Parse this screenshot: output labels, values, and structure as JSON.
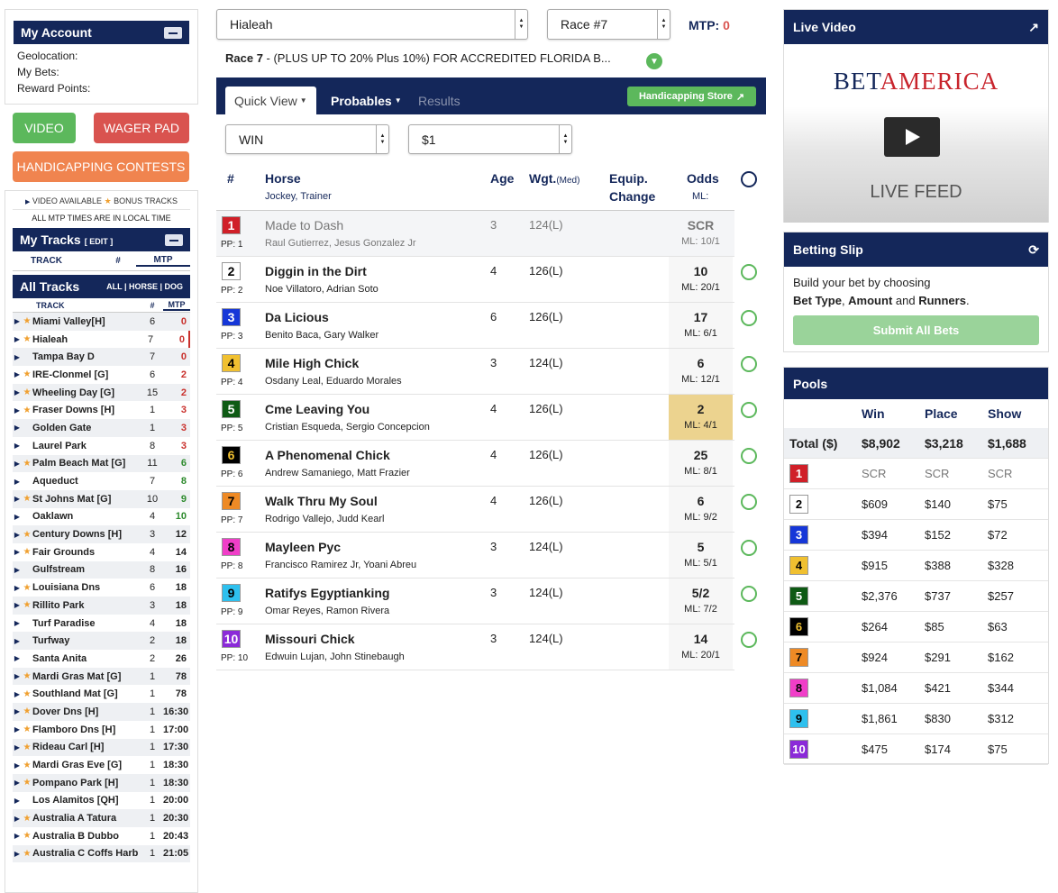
{
  "account": {
    "title": "My Account",
    "geo": "Geolocation:",
    "bets": "My Bets:",
    "points": "Reward Points:"
  },
  "buttons": {
    "video": "VIDEO",
    "wager": "WAGER PAD",
    "contests": "HANDICAPPING CONTESTS"
  },
  "legend": {
    "video": "VIDEO AVAILABLE",
    "bonus": "BONUS TRACKS",
    "times": "ALL MTP TIMES ARE IN LOCAL TIME"
  },
  "mytracks": {
    "title": "My Tracks",
    "edit": "[ EDIT ]",
    "col_track": "TRACK",
    "col_num": "#",
    "col_mtp": "MTP"
  },
  "alltracks": {
    "title": "All Tracks",
    "filter": "ALL | HORSE | DOG",
    "col_track": "TRACK",
    "col_num": "#",
    "col_mtp": "MTP"
  },
  "tracks": [
    {
      "name": "Miami Valley[H]",
      "n": "6",
      "m": "0",
      "star": true,
      "c": "red"
    },
    {
      "name": "Hialeah",
      "n": "7",
      "m": "0",
      "star": true,
      "c": "red"
    },
    {
      "name": "Tampa Bay D",
      "n": "7",
      "m": "0",
      "star": false,
      "c": "red"
    },
    {
      "name": "IRE-Clonmel [G]",
      "n": "6",
      "m": "2",
      "star": true,
      "c": "red"
    },
    {
      "name": "Wheeling Day [G]",
      "n": "15",
      "m": "2",
      "star": true,
      "c": "red"
    },
    {
      "name": "Fraser Downs [H]",
      "n": "1",
      "m": "3",
      "star": true,
      "c": "red"
    },
    {
      "name": "Golden Gate",
      "n": "1",
      "m": "3",
      "star": false,
      "c": "red"
    },
    {
      "name": "Laurel Park",
      "n": "8",
      "m": "3",
      "star": false,
      "c": "red"
    },
    {
      "name": "Palm Beach Mat [G]",
      "n": "11",
      "m": "6",
      "star": true,
      "c": "green"
    },
    {
      "name": "Aqueduct",
      "n": "7",
      "m": "8",
      "star": false,
      "c": "green"
    },
    {
      "name": "St Johns Mat [G]",
      "n": "10",
      "m": "9",
      "star": true,
      "c": "green"
    },
    {
      "name": "Oaklawn",
      "n": "4",
      "m": "10",
      "star": false,
      "c": "green"
    },
    {
      "name": "Century Downs [H]",
      "n": "3",
      "m": "12",
      "star": true,
      "c": "dark"
    },
    {
      "name": "Fair Grounds",
      "n": "4",
      "m": "14",
      "star": true,
      "c": "dark"
    },
    {
      "name": "Gulfstream",
      "n": "8",
      "m": "16",
      "star": false,
      "c": "dark"
    },
    {
      "name": "Louisiana Dns",
      "n": "6",
      "m": "18",
      "star": true,
      "c": "dark"
    },
    {
      "name": "Rillito Park",
      "n": "3",
      "m": "18",
      "star": true,
      "c": "dark"
    },
    {
      "name": "Turf Paradise",
      "n": "4",
      "m": "18",
      "star": false,
      "c": "dark"
    },
    {
      "name": "Turfway",
      "n": "2",
      "m": "18",
      "star": false,
      "c": "dark"
    },
    {
      "name": "Santa Anita",
      "n": "2",
      "m": "26",
      "star": false,
      "c": "dark"
    },
    {
      "name": "Mardi Gras Mat [G]",
      "n": "1",
      "m": "78",
      "star": true,
      "c": "dark"
    },
    {
      "name": "Southland Mat [G]",
      "n": "1",
      "m": "78",
      "star": true,
      "c": "dark"
    },
    {
      "name": "Dover Dns [H]",
      "n": "1",
      "m": "16:30",
      "star": true,
      "c": "dark"
    },
    {
      "name": "Flamboro Dns [H]",
      "n": "1",
      "m": "17:00",
      "star": true,
      "c": "dark"
    },
    {
      "name": "Rideau Carl [H]",
      "n": "1",
      "m": "17:30",
      "star": true,
      "c": "dark"
    },
    {
      "name": "Mardi Gras Eve [G]",
      "n": "1",
      "m": "18:30",
      "star": true,
      "c": "dark"
    },
    {
      "name": "Pompano Park [H]",
      "n": "1",
      "m": "18:30",
      "star": true,
      "c": "dark"
    },
    {
      "name": "Los Alamitos [QH]",
      "n": "1",
      "m": "20:00",
      "star": false,
      "c": "dark"
    },
    {
      "name": "Australia A Tatura",
      "n": "1",
      "m": "20:30",
      "star": true,
      "c": "dark"
    },
    {
      "name": "Australia B Dubbo",
      "n": "1",
      "m": "20:43",
      "star": true,
      "c": "dark"
    },
    {
      "name": "Australia C Coffs Harb",
      "n": "1",
      "m": "21:05",
      "star": true,
      "c": "dark"
    }
  ],
  "race": {
    "track": "Hialeah",
    "race": "Race #7",
    "mtp_label": "MTP:",
    "mtp": "0",
    "title_prefix": "Race 7",
    "title": " - (PLUS UP TO 20% Plus 10%) FOR ACCREDITED FLORIDA B..."
  },
  "tabs": {
    "quick": "Quick View",
    "probables": "Probables",
    "results": "Results",
    "store": "Handicapping Store"
  },
  "filters": {
    "type": "WIN",
    "amount": "$1"
  },
  "headers": {
    "num": "#",
    "horse": "Horse",
    "jockey": "Jockey, Trainer",
    "age": "Age",
    "wgt": "Wgt.",
    "med": "(Med)",
    "equip1": "Equip.",
    "equip2": "Change",
    "odds": "Odds",
    "ml": "ML:"
  },
  "runners": [
    {
      "n": "1",
      "pp": "PP: 1",
      "horse": "Made to Dash",
      "jt": "Raul Gutierrez, Jesus Gonzalez Jr",
      "age": "3",
      "wgt": "124(L)",
      "odds": "SCR",
      "ml": "ML: 10/1",
      "bg": "#d01f28",
      "fg": "#fff",
      "scr": true
    },
    {
      "n": "2",
      "pp": "PP: 2",
      "horse": "Diggin in the Dirt",
      "jt": "Noe Villatoro, Adrian Soto",
      "age": "4",
      "wgt": "126(L)",
      "odds": "10",
      "ml": "ML: 20/1",
      "bg": "#ffffff",
      "fg": "#000"
    },
    {
      "n": "3",
      "pp": "PP: 3",
      "horse": "Da Licious",
      "jt": "Benito Baca, Gary Walker",
      "age": "6",
      "wgt": "126(L)",
      "odds": "17",
      "ml": "ML: 6/1",
      "bg": "#1637d8",
      "fg": "#fff"
    },
    {
      "n": "4",
      "pp": "PP: 4",
      "horse": "Mile High Chick",
      "jt": "Osdany Leal, Eduardo Morales",
      "age": "3",
      "wgt": "124(L)",
      "odds": "6",
      "ml": "ML: 12/1",
      "bg": "#f0c030",
      "fg": "#000"
    },
    {
      "n": "5",
      "pp": "PP: 5",
      "horse": "Cme Leaving You",
      "jt": "Cristian Esqueda, Sergio Concepcion",
      "age": "4",
      "wgt": "126(L)",
      "odds": "2",
      "ml": "ML: 4/1",
      "bg": "#0e5a14",
      "fg": "#fff",
      "fav": true
    },
    {
      "n": "6",
      "pp": "PP: 6",
      "horse": "A Phenomenal Chick",
      "jt": "Andrew Samaniego, Matt Frazier",
      "age": "4",
      "wgt": "126(L)",
      "odds": "25",
      "ml": "ML: 8/1",
      "bg": "#000000",
      "fg": "#f0c030"
    },
    {
      "n": "7",
      "pp": "PP: 7",
      "horse": "Walk Thru My Soul",
      "jt": "Rodrigo Vallejo, Judd Kearl",
      "age": "4",
      "wgt": "126(L)",
      "odds": "6",
      "ml": "ML: 9/2",
      "bg": "#ee8a25",
      "fg": "#000"
    },
    {
      "n": "8",
      "pp": "PP: 8",
      "horse": "Mayleen Pyc",
      "jt": "Francisco Ramirez Jr, Yoani Abreu",
      "age": "3",
      "wgt": "124(L)",
      "odds": "5",
      "ml": "ML: 5/1",
      "bg": "#f03ec8",
      "fg": "#000"
    },
    {
      "n": "9",
      "pp": "PP: 9",
      "horse": "Ratifys Egyptianking",
      "jt": "Omar Reyes, Ramon Rivera",
      "age": "3",
      "wgt": "124(L)",
      "odds": "5/2",
      "ml": "ML: 7/2",
      "bg": "#2ec0ee",
      "fg": "#000"
    },
    {
      "n": "10",
      "pp": "PP: 10",
      "horse": "Missouri Chick",
      "jt": "Edwuin Lujan, John Stinebaugh",
      "age": "3",
      "wgt": "124(L)",
      "odds": "14",
      "ml": "ML: 20/1",
      "bg": "#8b2ad8",
      "fg": "#fff"
    }
  ],
  "video": {
    "title": "Live Video",
    "brand_a": "BET",
    "brand_b": "AMERICA",
    "feed": "LIVE FEED"
  },
  "slip": {
    "title": "Betting Slip",
    "line1": "Build your bet by choosing",
    "bt": "Bet Type",
    "c1": ", ",
    "amt": "Amount",
    "and": " and ",
    "run": "Runners",
    "dot": ".",
    "submit": "Submit All Bets"
  },
  "pools": {
    "title": "Pools",
    "win": "Win",
    "place": "Place",
    "show": "Show",
    "total": "Total ($)",
    "tw": "$8,902",
    "tp": "$3,218",
    "ts": "$1,688",
    "rows": [
      {
        "n": "1",
        "w": "SCR",
        "p": "SCR",
        "s": "SCR"
      },
      {
        "n": "2",
        "w": "$609",
        "p": "$140",
        "s": "$75"
      },
      {
        "n": "3",
        "w": "$394",
        "p": "$152",
        "s": "$72"
      },
      {
        "n": "4",
        "w": "$915",
        "p": "$388",
        "s": "$328"
      },
      {
        "n": "5",
        "w": "$2,376",
        "p": "$737",
        "s": "$257"
      },
      {
        "n": "6",
        "w": "$264",
        "p": "$85",
        "s": "$63"
      },
      {
        "n": "7",
        "w": "$924",
        "p": "$291",
        "s": "$162"
      },
      {
        "n": "8",
        "w": "$1,084",
        "p": "$421",
        "s": "$344"
      },
      {
        "n": "9",
        "w": "$1,861",
        "p": "$830",
        "s": "$312"
      },
      {
        "n": "10",
        "w": "$475",
        "p": "$174",
        "s": "$75"
      }
    ]
  },
  "colors": {
    "navy": "#14275a",
    "green": "#5cb85c",
    "red": "#d9534f",
    "orange": "#f0844f",
    "fav": "#ecd38f"
  }
}
